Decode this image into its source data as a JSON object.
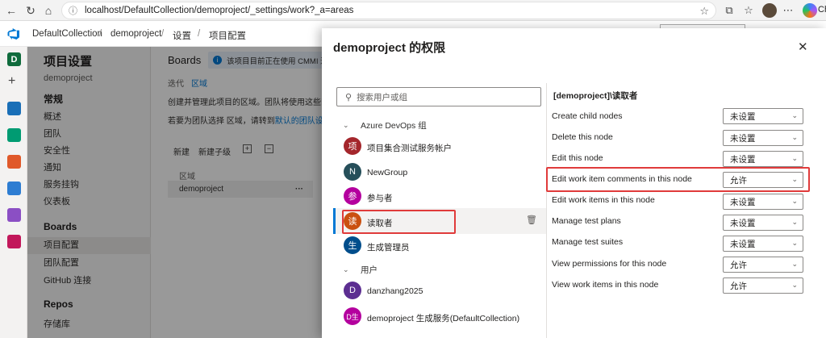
{
  "browser": {
    "url": "localhost/DefaultCollection/demoproject/_settings/work?_a=areas",
    "profile_label": "Ch"
  },
  "header": {
    "breadcrumbs": [
      "DefaultCollection",
      "demoproject",
      "设置",
      "项目配置"
    ]
  },
  "rail": {
    "org_letter": "D"
  },
  "sidebar": {
    "title": "项目设置",
    "subtitle": "demoproject",
    "sections": [
      {
        "label": "常规",
        "items": [
          "概述",
          "团队",
          "安全性",
          "通知",
          "服务挂钩",
          "仪表板"
        ]
      },
      {
        "label": "Boards",
        "items": [
          "项目配置",
          "团队配置",
          "GitHub 连接"
        ]
      },
      {
        "label": "Repos",
        "items": [
          "存储库"
        ]
      }
    ],
    "selected_item": "项目配置"
  },
  "main": {
    "title": "Boards",
    "banner": "该项目目前正在使用 CMMI 进程。",
    "tabs": [
      "迭代",
      "区域"
    ],
    "active_tab": "区域",
    "line1": "创建并管理此项目的区域。团队将使用这些区域",
    "line2_prefix": "若要为团队选择 区域，请转到",
    "line2_link": "默认的团队设置。",
    "toolbar": [
      "新建",
      "新建子级"
    ],
    "grid_header": "区域",
    "grid_row": "demoproject",
    "grid_row_more": "···"
  },
  "panel": {
    "title": "demoproject 的权限",
    "search_placeholder": "搜索用户或组",
    "groups": [
      {
        "label": "Azure DevOps 组",
        "members": [
          {
            "name": "项目集合测试服务帐户",
            "initial": "项",
            "color": "#a4262c"
          },
          {
            "name": "NewGroup",
            "initial": "N",
            "color": "#264f5a"
          },
          {
            "name": "参与者",
            "initial": "参",
            "color": "#b4009e"
          },
          {
            "name": "读取者",
            "initial": "读",
            "color": "#ca5010",
            "selected": true
          },
          {
            "name": "生成管理员",
            "initial": "生",
            "color": "#004e8c"
          }
        ]
      },
      {
        "label": "用户",
        "members": [
          {
            "name": "danzhang2025",
            "initial": "D",
            "color": "#5c2e91"
          },
          {
            "name": "demoproject 生成服务(DefaultCollection)",
            "initial": "D生",
            "color": "#b4009e"
          }
        ]
      }
    ],
    "permissions_header": "[demoproject]\\读取者",
    "permissions": [
      {
        "label": "Create child nodes",
        "value": "未设置"
      },
      {
        "label": "Delete this node",
        "value": "未设置"
      },
      {
        "label": "Edit this node",
        "value": "未设置"
      },
      {
        "label": "Edit work item comments in this node",
        "value": "允许"
      },
      {
        "label": "Edit work items in this node",
        "value": "未设置"
      },
      {
        "label": "Manage test plans",
        "value": "未设置"
      },
      {
        "label": "Manage test suites",
        "value": "未设置"
      },
      {
        "label": "View permissions for this node",
        "value": "允许"
      },
      {
        "label": "View work items in this node",
        "value": "允许"
      }
    ]
  }
}
